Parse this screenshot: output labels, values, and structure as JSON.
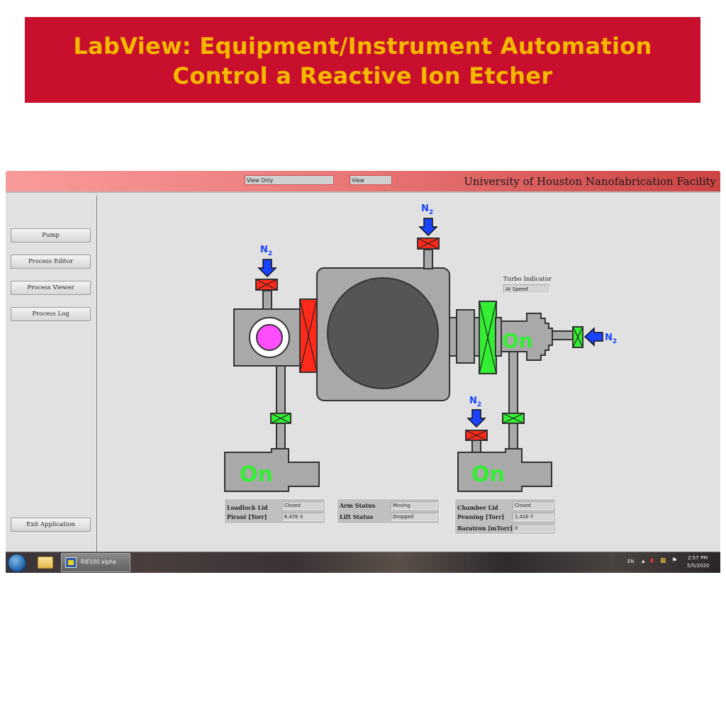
{
  "banner": {
    "line1": "LabView: Equipment/Instrument Automation",
    "line2": "Control a Reactive Ion Etcher",
    "background": "#c8102e",
    "text_color": "#f5b800"
  },
  "header": {
    "mode_field": "View Only",
    "access_field": "View",
    "facility_title": "University of Houston Nanofabrication Facility"
  },
  "sidebar": {
    "buttons": [
      {
        "label": "Pump"
      },
      {
        "label": "Process Editor"
      },
      {
        "label": "Process Viewer"
      },
      {
        "label": "Process Log"
      }
    ],
    "exit_label": "Exit Application"
  },
  "diagram": {
    "n2_label": "N",
    "n2_sub": "2",
    "loadlock_pump_label": "On",
    "chamber_pump_label": "On",
    "turbo_pump_label": "On",
    "turbo_indicator_label": "Turbo Indicator",
    "turbo_indicator_value": "At Speed",
    "colors": {
      "valve_closed": "#ff2a1a",
      "valve_open": "#33ee33",
      "body": "#a9a9a9",
      "chamber_core": "#555555",
      "n2_arrow": "#1a44ff",
      "wafer": "#ff4dff"
    }
  },
  "status_panels": {
    "loadlock": [
      {
        "label": "Loadlock Lid",
        "value": "Closed"
      },
      {
        "label": "Pirani [Torr]",
        "value": "6.47E-3"
      }
    ],
    "robot": [
      {
        "label": "Arm Status",
        "value": "Moving"
      },
      {
        "label": "Lift Status",
        "value": "Dropped"
      }
    ],
    "chamber": [
      {
        "label": "Chamber Lid",
        "value": "Closed"
      },
      {
        "label": "Penning [Torr]",
        "value": "1.42E-7"
      },
      {
        "label": "Baratron [mTorr]",
        "value": "0"
      }
    ]
  },
  "taskbar": {
    "task_label": "RIE100 alpha",
    "language": "EN",
    "time": "2:57 PM",
    "date": "5/5/2020"
  }
}
